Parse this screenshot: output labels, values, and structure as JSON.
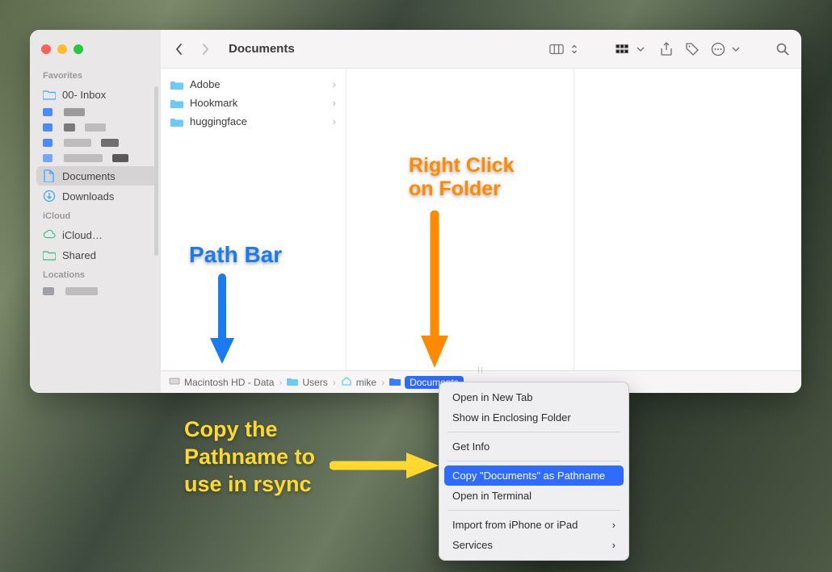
{
  "window": {
    "title": "Documents"
  },
  "sidebar": {
    "sections": {
      "favorites": "Favorites",
      "icloud": "iCloud",
      "locations": "Locations"
    },
    "favorites": {
      "inbox": "00- Inbox",
      "documents": "Documents",
      "downloads": "Downloads"
    },
    "icloud": {
      "drive": "iCloud…",
      "shared": "Shared"
    }
  },
  "column": {
    "items": [
      {
        "name": "Adobe"
      },
      {
        "name": "Hookmark"
      },
      {
        "name": "huggingface"
      }
    ]
  },
  "path": {
    "crumbs": [
      {
        "label": "Macintosh HD - Data",
        "type": "disk"
      },
      {
        "label": "Users",
        "type": "folder"
      },
      {
        "label": "mike",
        "type": "folder"
      },
      {
        "label": "Documents",
        "type": "folder",
        "selected": true
      }
    ]
  },
  "context_menu": {
    "open_tab": "Open in New Tab",
    "show_enclosing": "Show in Enclosing Folder",
    "get_info": "Get Info",
    "copy_pathname": "Copy \"Documents\" as Pathname",
    "open_terminal": "Open in Terminal",
    "import": "Import from iPhone or iPad",
    "services": "Services"
  },
  "annotations": {
    "pathbar": "Path Bar",
    "right_click": "Right Click\non Folder",
    "copy_rsync": "Copy the\nPathname to\nuse in rsync"
  },
  "colors": {
    "accent": "#2f6bff",
    "anno_blue": "#1a7af0",
    "anno_orange": "#ff8a00",
    "anno_yellow": "#ffd92e"
  }
}
